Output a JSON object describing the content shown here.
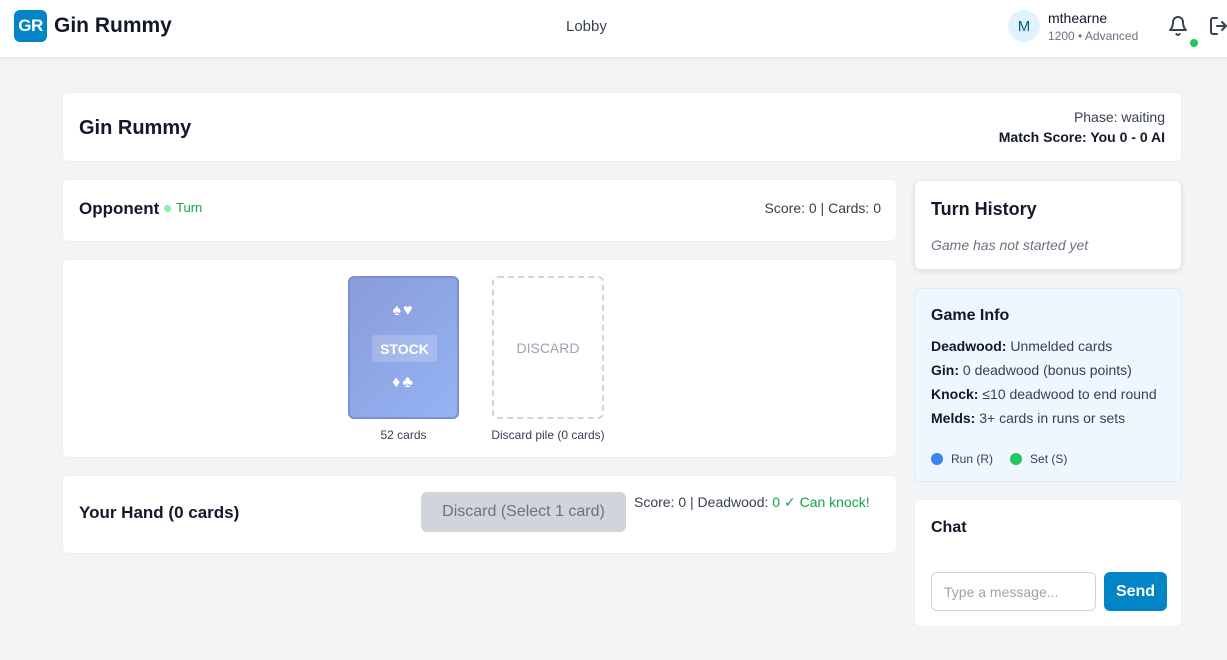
{
  "nav": {
    "logo_text": "GR",
    "app_title": "Gin Rummy",
    "lobby_link": "Lobby",
    "user": {
      "avatar_initial": "M",
      "name": "mthearne",
      "meta": "1200 • Advanced",
      "online": true
    },
    "icons": [
      "bell-icon",
      "logout-icon"
    ]
  },
  "header": {
    "title": "Gin Rummy",
    "phase": "Phase: waiting",
    "match_score": "Match Score: You 0 - 0 AI"
  },
  "opponent": {
    "label": "Opponent",
    "turn_label": "Turn",
    "stats": "Score: 0 | Cards: 0"
  },
  "table": {
    "stock": {
      "label": "STOCK",
      "suits_top": "♠♥",
      "suits_bottom": "♦♣",
      "count_text": "52 cards"
    },
    "discard": {
      "label": "DISCARD",
      "count_text": "Discard pile (0 cards)"
    }
  },
  "hand": {
    "title": "Your Hand (0 cards)",
    "discard_button": "Discard (Select 1 card)",
    "score_text": "Score: 0 | Deadwood: ",
    "deadwood_value": "0 ✓ Can knock!"
  },
  "history": {
    "title": "Turn History",
    "empty_text": "Game has not started yet"
  },
  "game_info": {
    "title": "Game Info",
    "rules": [
      {
        "term": "Deadwood:",
        "text": " Unmelded cards"
      },
      {
        "term": "Gin:",
        "text": " 0 deadwood (bonus points)"
      },
      {
        "term": "Knock:",
        "text": " ≤10 deadwood to end round"
      },
      {
        "term": "Melds:",
        "text": " 3+ cards in runs or sets"
      }
    ],
    "legend": {
      "run": "Run (R)",
      "set": "Set (S)"
    }
  },
  "chat": {
    "title": "Chat",
    "placeholder": "Type a message...",
    "value": "",
    "send_label": "Send"
  },
  "colors": {
    "brand": "#0284c7",
    "success": "#16a34a",
    "run": "#3b82f6",
    "set": "#22c55e",
    "stock_gradient_start": "#8b9bd9",
    "stock_gradient_end": "#93b4f5"
  }
}
